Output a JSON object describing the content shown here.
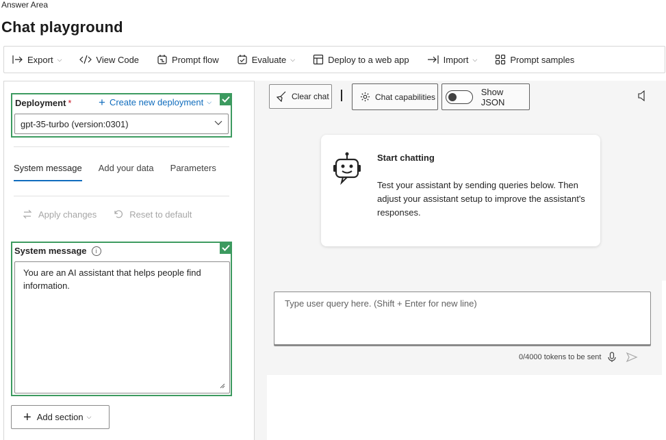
{
  "header": {
    "answer_area": "Answer Area",
    "title": "Chat playground"
  },
  "toolbar": {
    "items": [
      {
        "label": "Export",
        "icon": "export-icon",
        "has_dropdown": true
      },
      {
        "label": "View Code",
        "icon": "code-icon",
        "has_dropdown": false
      },
      {
        "label": "Prompt flow",
        "icon": "prompt-flow-icon",
        "has_dropdown": false
      },
      {
        "label": "Evaluate",
        "icon": "evaluate-icon",
        "has_dropdown": true
      },
      {
        "label": "Deploy to a web app",
        "icon": "web-app-icon",
        "has_dropdown": false
      },
      {
        "label": "Import",
        "icon": "import-icon",
        "has_dropdown": true
      },
      {
        "label": "Prompt samples",
        "icon": "samples-icon",
        "has_dropdown": false
      }
    ]
  },
  "deployment": {
    "label": "Deployment",
    "required_mark": "*",
    "create_link": "Create new deployment",
    "selected": "gpt-35-turbo (version:0301)"
  },
  "tabs": [
    {
      "label": "System message",
      "active": true
    },
    {
      "label": "Add your data",
      "active": false
    },
    {
      "label": "Parameters",
      "active": false
    }
  ],
  "actions": {
    "apply": "Apply changes",
    "reset": "Reset to default"
  },
  "system_message": {
    "label": "System message",
    "info_glyph": "i",
    "text": "You are an AI assistant that helps people find information."
  },
  "add_section": {
    "label": "Add section"
  },
  "chat_toolbar": {
    "clear_chat": "Clear chat",
    "chat_capabilities": "Chat capabilities",
    "show_json": "Show JSON"
  },
  "start_card": {
    "title": "Start chatting",
    "body": "Test your assistant by sending queries below. Then adjust your assistant setup to improve the assistant's responses."
  },
  "query": {
    "placeholder": "Type user query here. (Shift + Enter for new line)",
    "tokens": "0/4000 tokens to be sent"
  },
  "colors": {
    "accent": "#0f6cbd",
    "highlight_border": "#3c9a5f",
    "panel_bg": "#f5f5f5"
  }
}
